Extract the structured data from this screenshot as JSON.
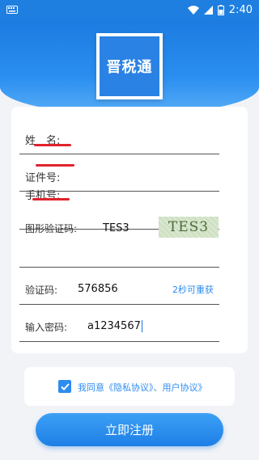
{
  "status_bar": {
    "time": "2:40",
    "icons": [
      "keyboard-icon",
      "wifi-icon",
      "signal-icon",
      "battery-icon"
    ]
  },
  "logo": {
    "text": "晋税通"
  },
  "form": {
    "name_label": "姓　名:",
    "id_label": "证件号:",
    "phone_label": "手机号:",
    "image_captcha_label": "图形验证码:",
    "image_captcha_value": "TES3",
    "captcha_image_text": "TES3",
    "sms_code_label": "验证码:",
    "sms_code_value": "576856",
    "resend_text": "2秒可重获",
    "password_label": "输入密码:",
    "password_value": "a1234567"
  },
  "agreement": {
    "checked": true,
    "text": "我同意《隐私协议》、用户协议》"
  },
  "register_button": {
    "label": "立即注册"
  },
  "colors": {
    "brand_blue": "#2d8cf0",
    "header_blue": "#1f7fe0",
    "error_red": "#e0222c"
  }
}
